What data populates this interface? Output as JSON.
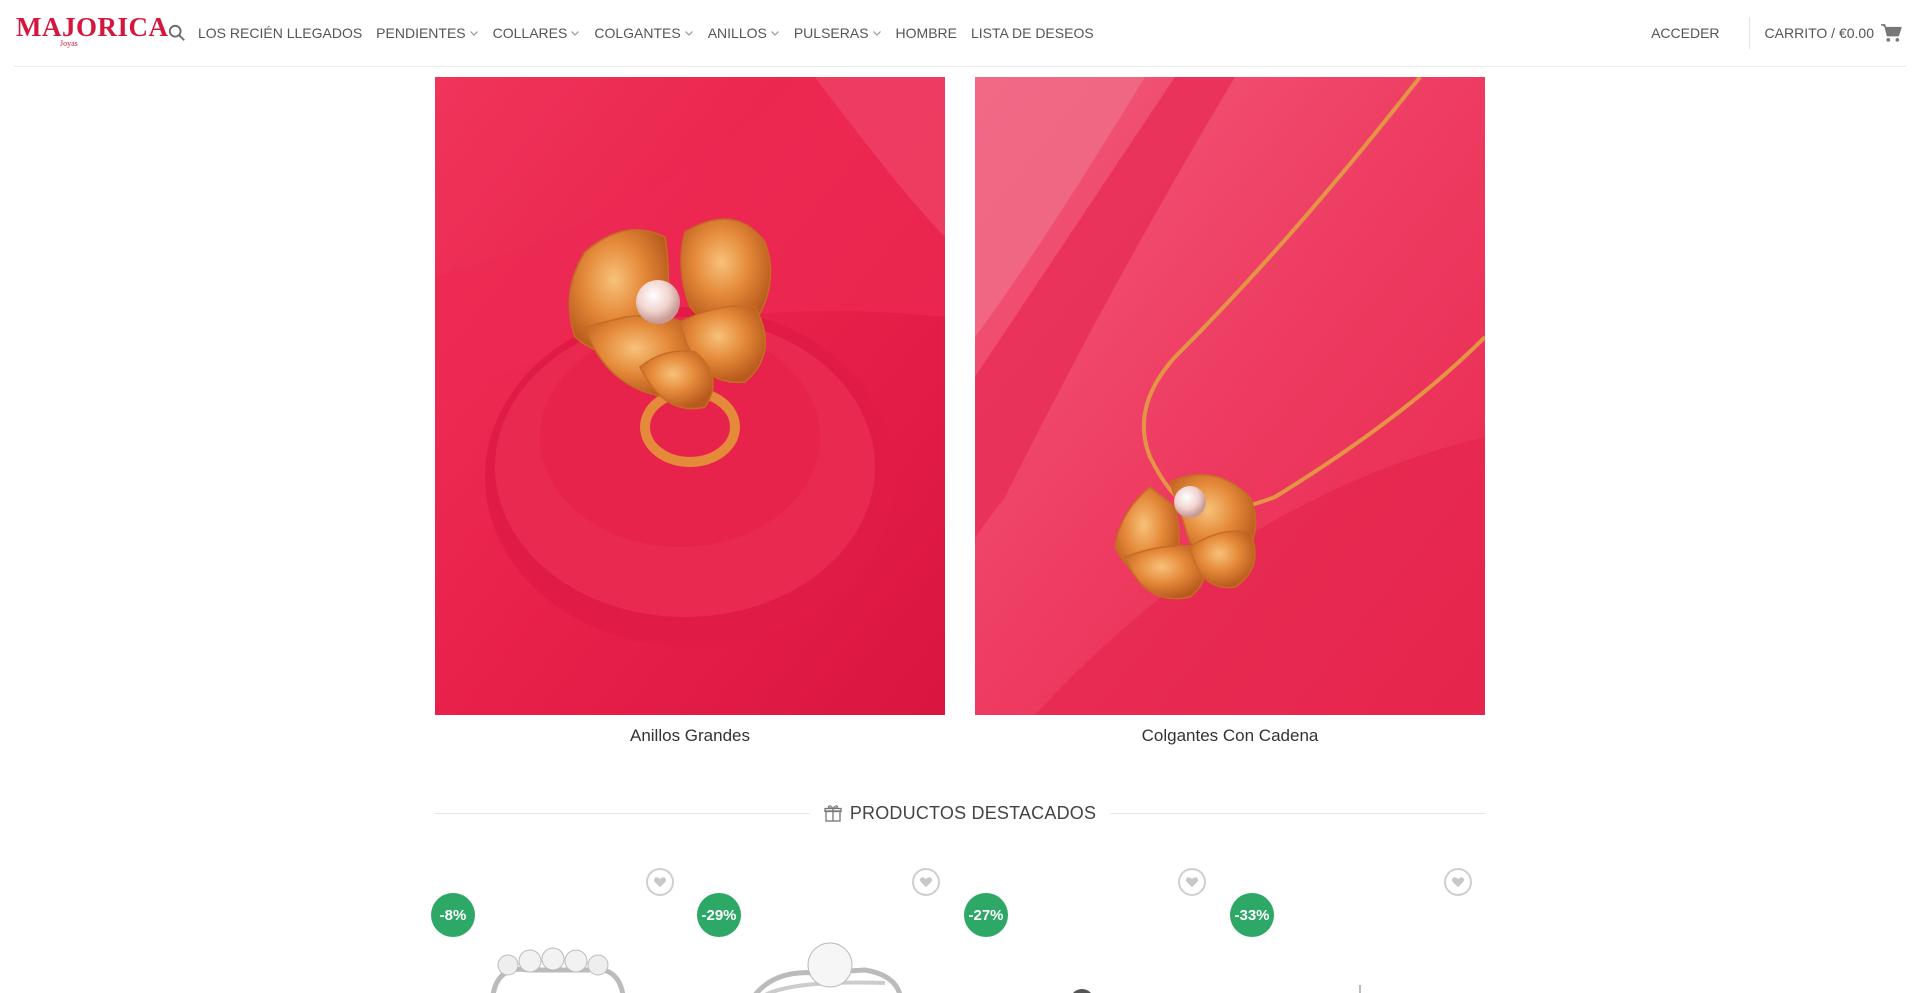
{
  "header": {
    "logo_text": "MAJORICA",
    "logo_sub": "Joyas",
    "nav": [
      {
        "label": "LOS RECIÉN LLEGADOS",
        "has_dropdown": false
      },
      {
        "label": "PENDIENTES",
        "has_dropdown": true
      },
      {
        "label": "COLLARES",
        "has_dropdown": true
      },
      {
        "label": "COLGANTES",
        "has_dropdown": true
      },
      {
        "label": "ANILLOS",
        "has_dropdown": true
      },
      {
        "label": "PULSERAS",
        "has_dropdown": true
      },
      {
        "label": "HOMBRE",
        "has_dropdown": false
      },
      {
        "label": "LISTA DE DESEOS",
        "has_dropdown": false
      }
    ],
    "login_label": "ACCEDER",
    "cart_label": "CARRITO / €0.00"
  },
  "categories": [
    {
      "caption": "Anillos Grandes"
    },
    {
      "caption": "Colgantes Con Cadena"
    }
  ],
  "featured": {
    "title": "PRODUCTOS DESTACADOS",
    "products": [
      {
        "discount": "-8%"
      },
      {
        "discount": "-29%"
      },
      {
        "discount": "-27%"
      },
      {
        "discount": "-33%"
      }
    ]
  },
  "colors": {
    "brand": "#d4173f",
    "badge": "#2da866",
    "tile_bg": "#e8204a"
  }
}
